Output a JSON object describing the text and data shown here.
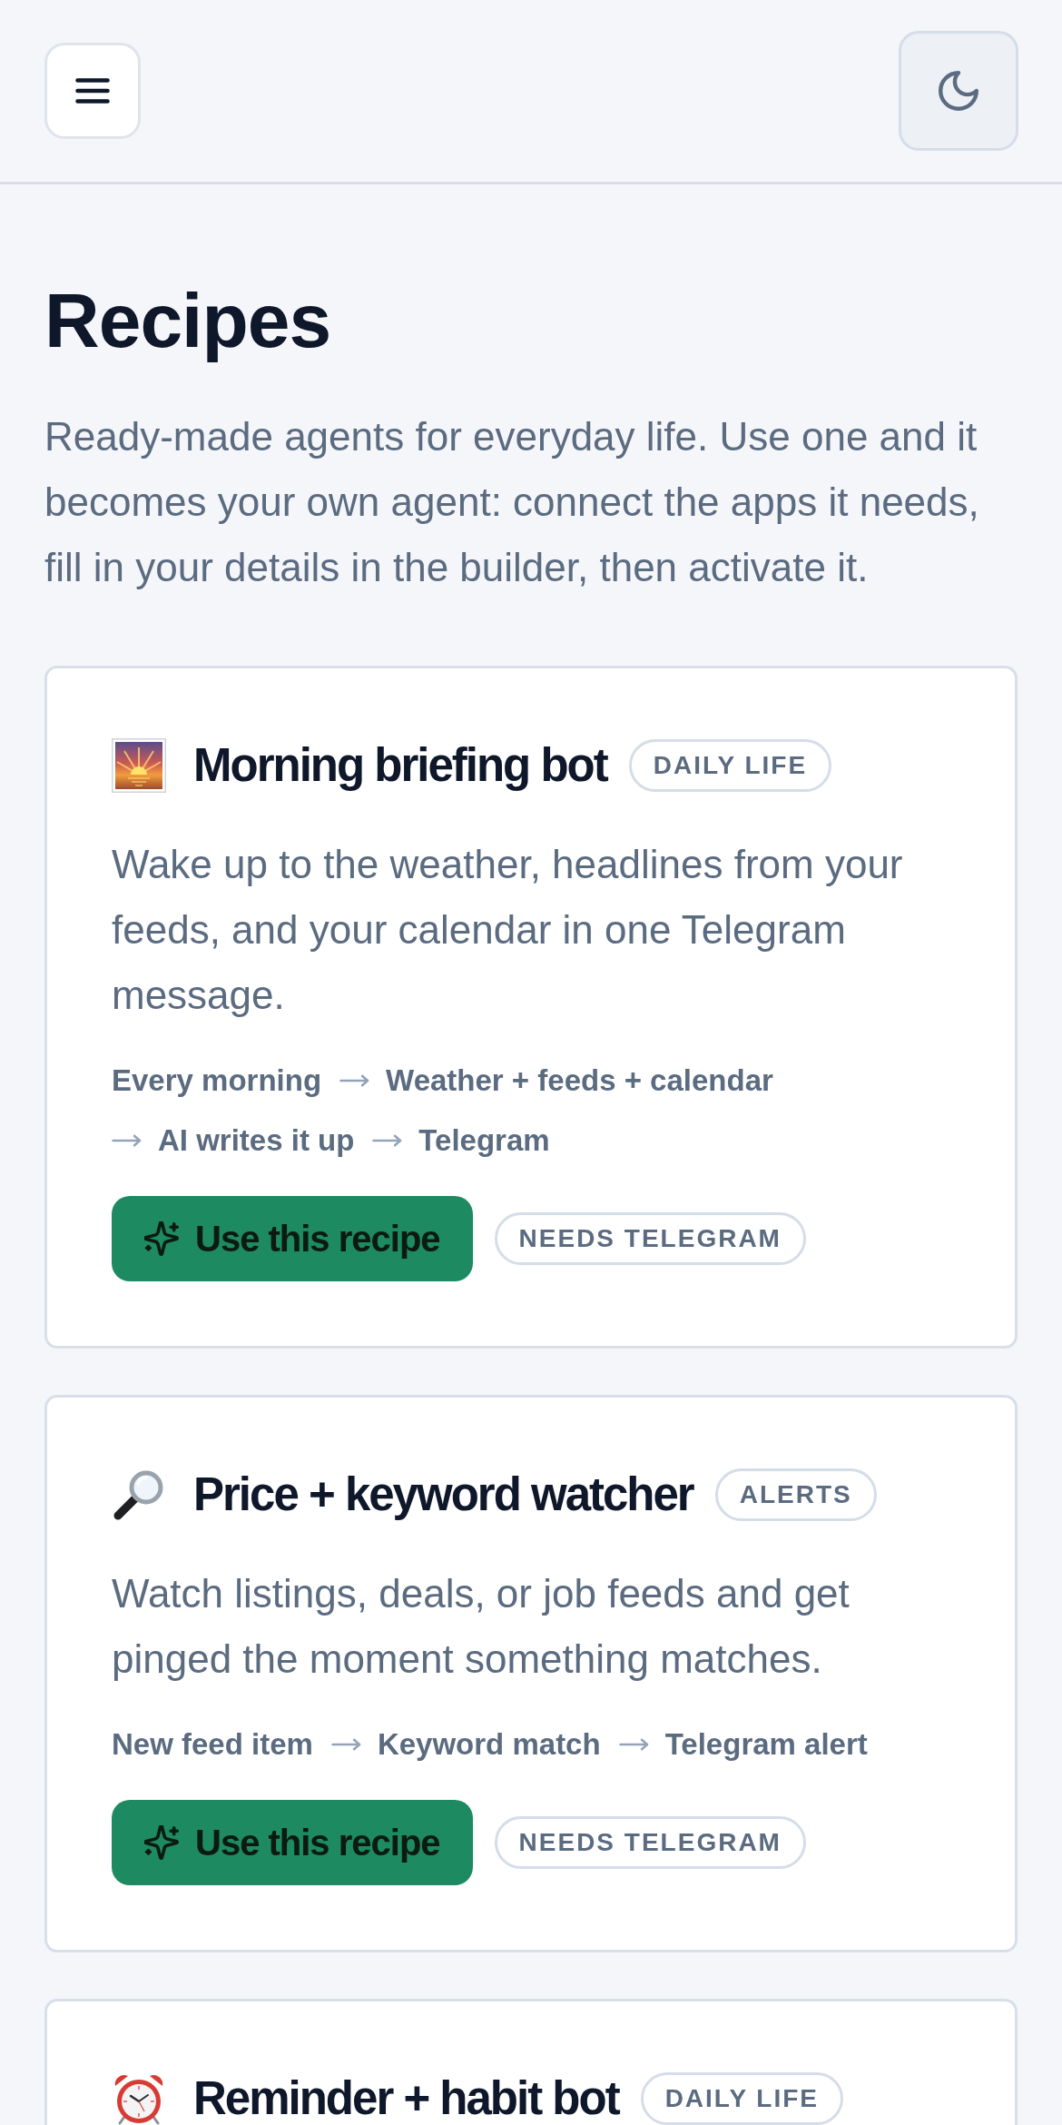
{
  "page": {
    "title": "Recipes",
    "description": "Ready-made agents for everyday life. Use one and it becomes your own agent: connect the apps it needs, fill in your details in the builder, then activate it."
  },
  "recipes": [
    {
      "kind": "sunrise",
      "title": "Morning briefing bot",
      "tag": "DAILY LIFE",
      "description": "Wake up to the weather, headlines from your feeds, and your calendar in one Telegram message.",
      "flow": [
        "Every morning",
        "Weather + feeds + calendar",
        "AI writes it up",
        "Telegram"
      ],
      "action": "Use this recipe",
      "requirement": "NEEDS TELEGRAM"
    },
    {
      "kind": "magnifier",
      "title": "Price + keyword watcher",
      "tag": "ALERTS",
      "description": "Watch listings, deals, or job feeds and get pinged the moment something matches.",
      "flow": [
        "New feed item",
        "Keyword match",
        "Telegram alert"
      ],
      "action": "Use this recipe",
      "requirement": "NEEDS TELEGRAM"
    },
    {
      "kind": "alarm",
      "title": "Reminder + habit bot",
      "tag": "DAILY LIFE"
    }
  ]
}
